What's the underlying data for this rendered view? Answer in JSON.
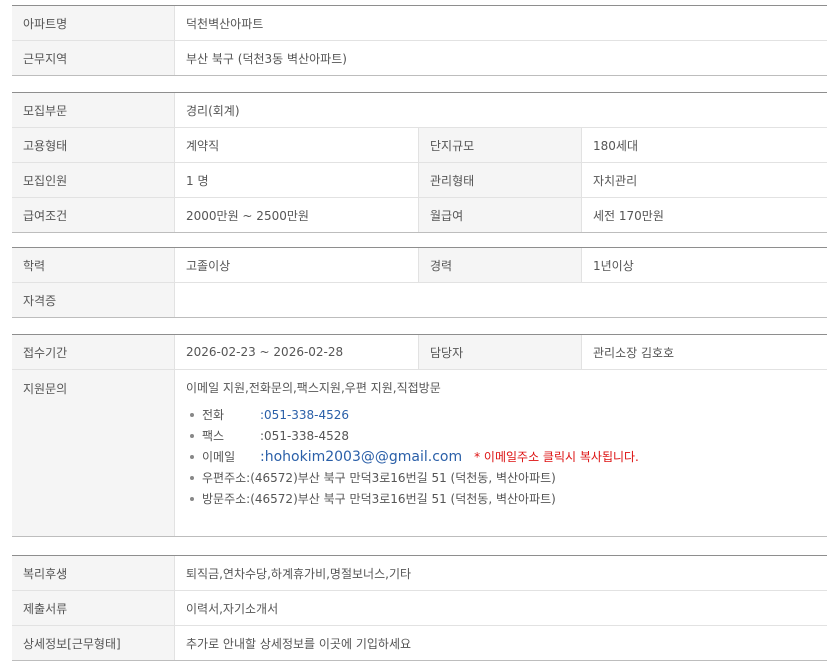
{
  "section1": {
    "apt_label": "아파트명",
    "apt_value": "덕천벽산아파트",
    "area_label": "근무지역",
    "area_value": "부산 북구 (덕천3동 벽산아파트)"
  },
  "section2": {
    "dept_label": "모집부문",
    "dept_value": "경리(회계)",
    "emp_label": "고용형태",
    "emp_value": "계약직",
    "size_label": "단지규모",
    "size_value": "180세대",
    "count_label": "모집인원",
    "count_value": "1 명",
    "mgmt_label": "관리형태",
    "mgmt_value": "자치관리",
    "salary_label": "급여조건",
    "salary_value": "2000만원 ~ 2500만원",
    "monthly_label": "월급여",
    "monthly_value": "세전 170만원"
  },
  "section3": {
    "edu_label": "학력",
    "edu_value": "고졸이상",
    "career_label": "경력",
    "career_value": "1년이상",
    "cert_label": "자격증",
    "cert_value": ""
  },
  "section4": {
    "period_label": "접수기간",
    "period_value": "2026-02-23 ~ 2026-02-28",
    "manager_label": "담당자",
    "manager_value": "관리소장 김호호",
    "contact_label": "지원문의",
    "contact_methods": "이메일 지원,전화문의,팩스지원,우편 지원,직접방문",
    "phone_label": "전화",
    "phone_value": ":051-338-4526",
    "fax_label": "팩스",
    "fax_value": ":051-338-4528",
    "email_label": "이메일",
    "email_value": ":hohokim2003@@gmail.com",
    "email_note": "* 이메일주소 클릭시 복사됩니다.",
    "post_label": "우편주소",
    "post_value": ":(46572)부산 북구 만덕3로16번길 51 (덕천동, 벽산아파트)",
    "visit_label": "방문주소",
    "visit_value": ":(46572)부산 북구 만덕3로16번길 51 (덕천동, 벽산아파트)"
  },
  "section5": {
    "welfare_label": "복리후생",
    "welfare_value": "퇴직금,연차수당,하계휴가비,명절보너스,기타",
    "docs_label": "제출서류",
    "docs_value": "이력서,자기소개서",
    "detail_label": "상세정보[근무형태]",
    "detail_value": "추가로 안내할 상세정보를 이곳에 기입하세요"
  }
}
